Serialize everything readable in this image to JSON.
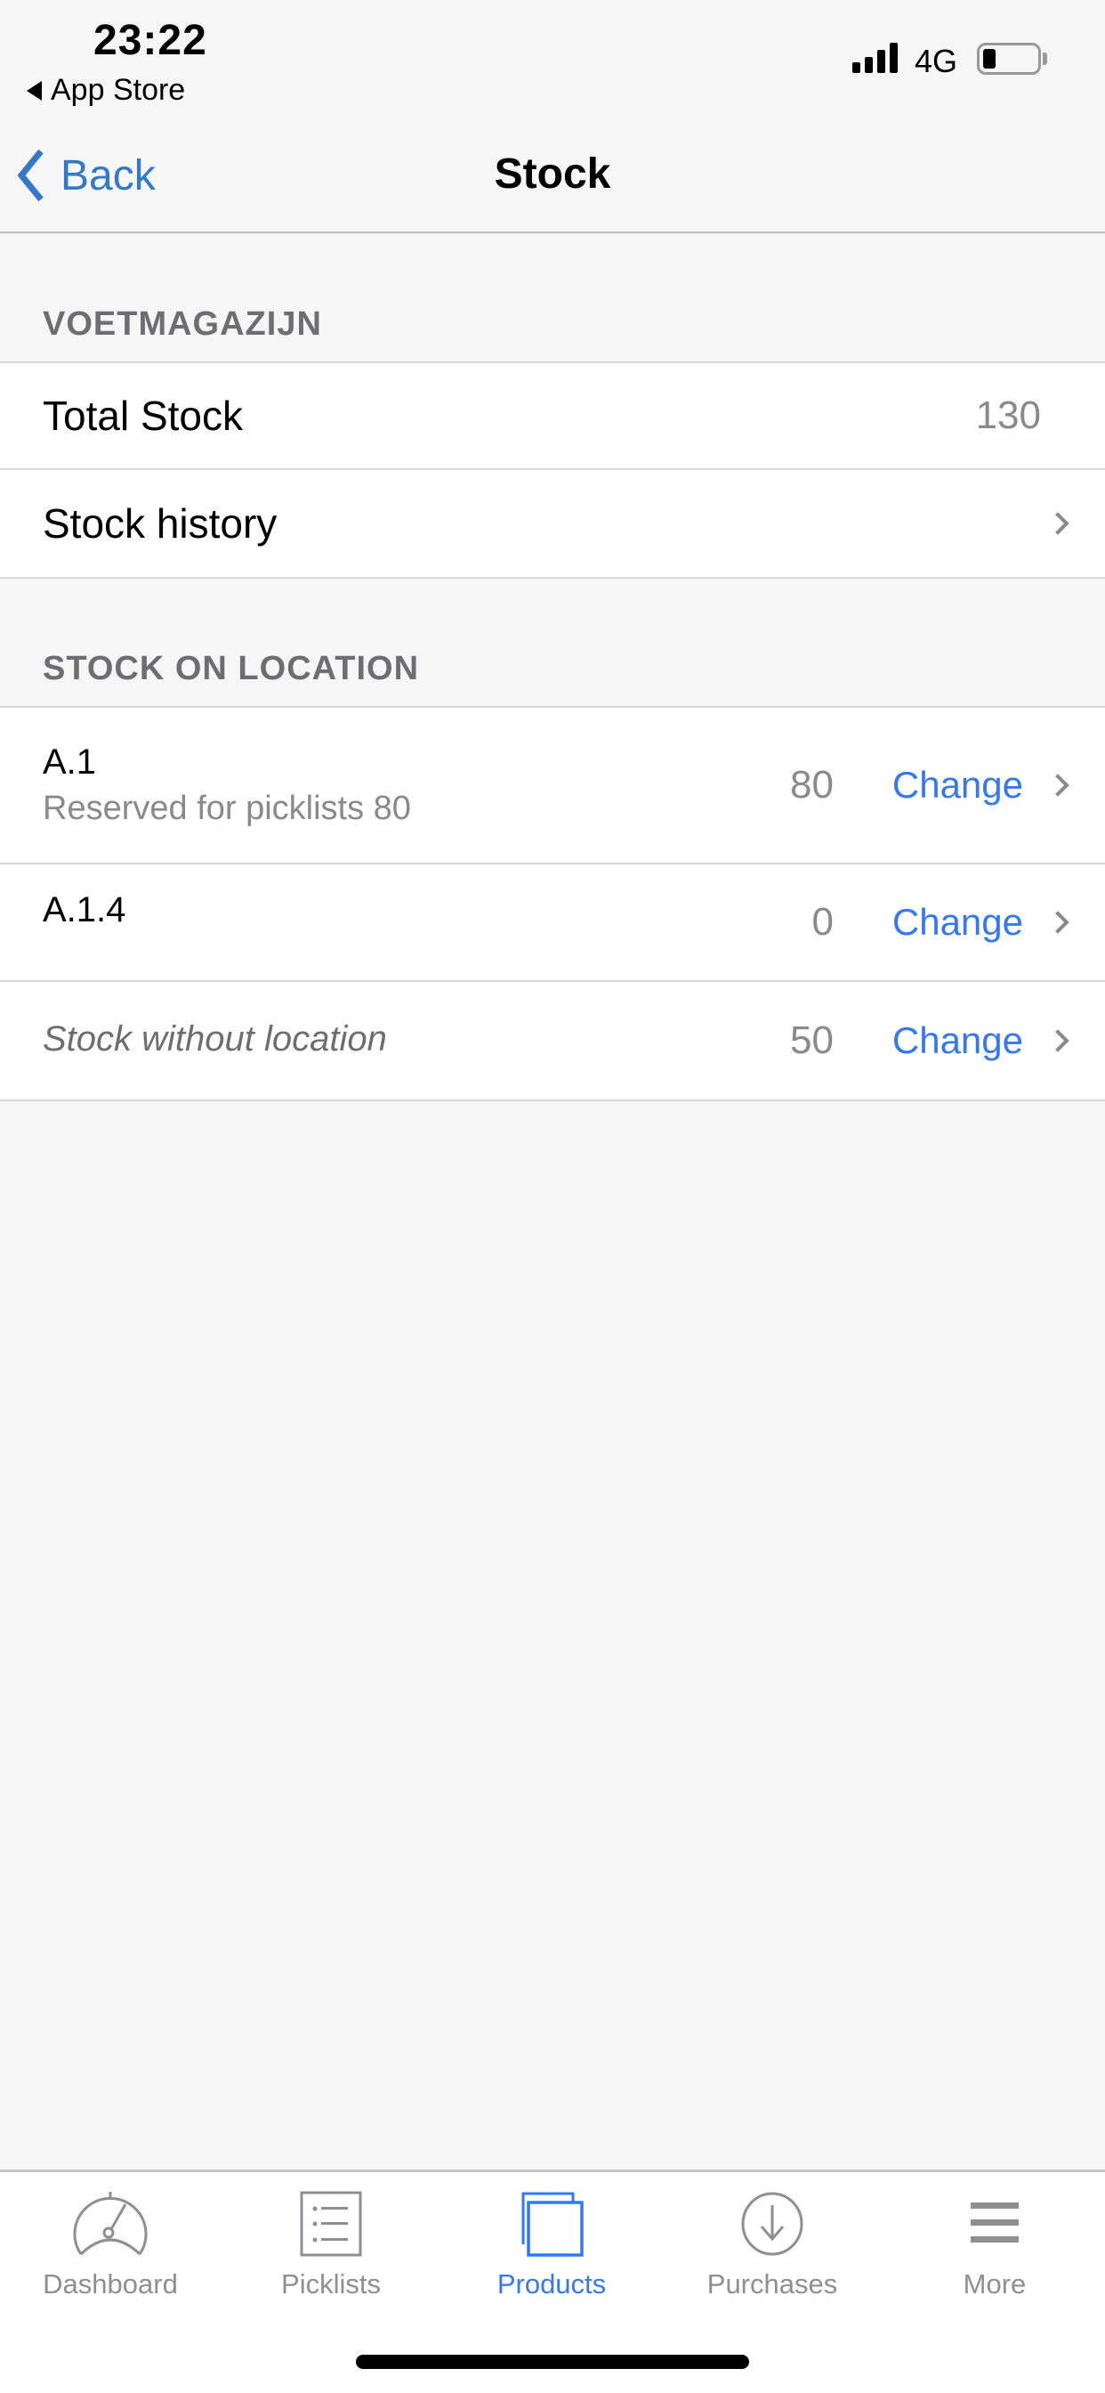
{
  "status_bar": {
    "time": "23:22",
    "back_app": "App Store",
    "network": "4G",
    "battery_level": 0.2
  },
  "nav": {
    "back_label": "Back",
    "title": "Stock"
  },
  "warehouse": {
    "header": "VOETMAGAZIJN",
    "total_stock_label": "Total Stock",
    "total_stock_value": "130",
    "stock_history_label": "Stock history"
  },
  "locations": {
    "header": "STOCK ON LOCATION",
    "change_label": "Change",
    "items": [
      {
        "name": "A.1",
        "subtitle": "Reserved for picklists 80",
        "quantity": "80"
      },
      {
        "name": "A.1.4",
        "quantity": "0"
      },
      {
        "name": "Stock without location",
        "quantity": "50"
      }
    ]
  },
  "tabs": [
    {
      "label": "Dashboard",
      "icon": "speedometer-icon"
    },
    {
      "label": "Picklists",
      "icon": "list-icon"
    },
    {
      "label": "Products",
      "icon": "documents-icon",
      "active": true
    },
    {
      "label": "Purchases",
      "icon": "download-circle-icon"
    },
    {
      "label": "More",
      "icon": "menu-icon"
    }
  ],
  "colors": {
    "accent": "#3478f6",
    "back": "#3478c8",
    "inactive": "#8e8e93"
  }
}
